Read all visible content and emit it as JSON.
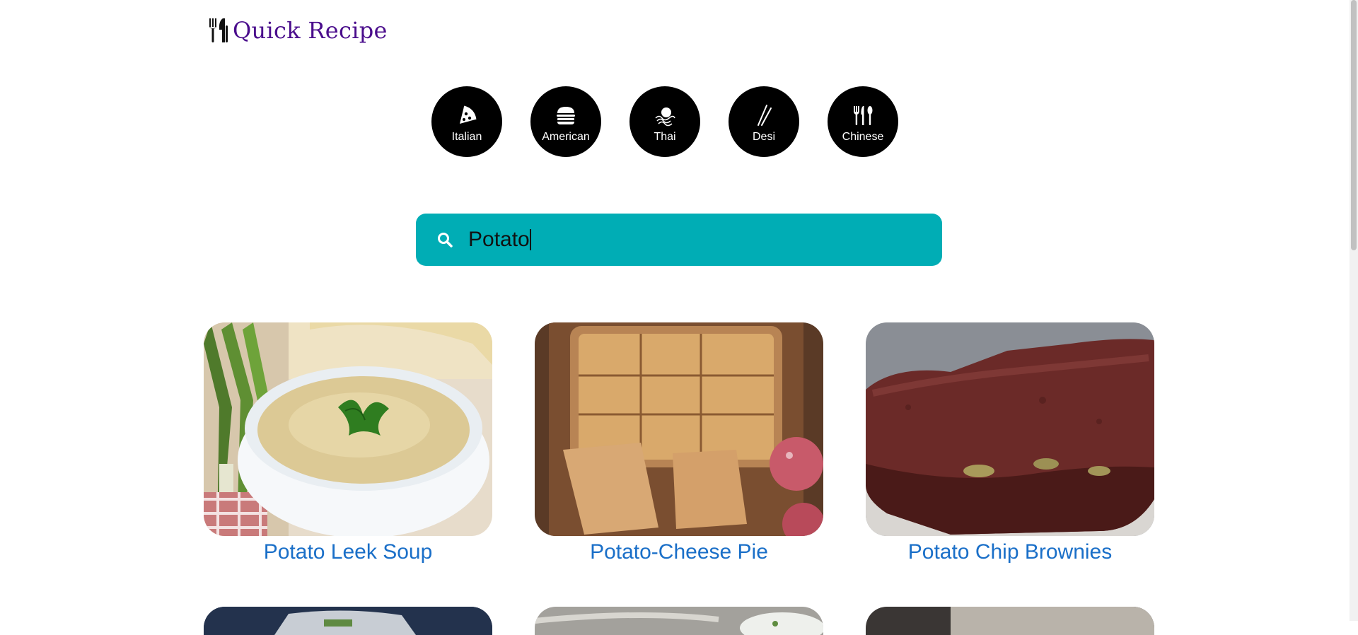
{
  "brand": {
    "name": "Quick Recipe",
    "color": "#4a0d8c",
    "icon": "fork-spoon-icon"
  },
  "cuisines": [
    {
      "label": "Italian",
      "icon": "pizza-icon"
    },
    {
      "label": "American",
      "icon": "burger-icon"
    },
    {
      "label": "Thai",
      "icon": "thai-noodle-icon"
    },
    {
      "label": "Desi",
      "icon": "chopsticks-icon"
    },
    {
      "label": "Chinese",
      "icon": "utensils-icon"
    }
  ],
  "search": {
    "value": "Potato",
    "icon": "search-icon",
    "color": "#00adb5"
  },
  "recipes": [
    {
      "title": "Potato Leek Soup"
    },
    {
      "title": "Potato-Cheese Pie"
    },
    {
      "title": "Potato Chip Brownies"
    }
  ],
  "colors": {
    "link": "#1a6fc8"
  }
}
